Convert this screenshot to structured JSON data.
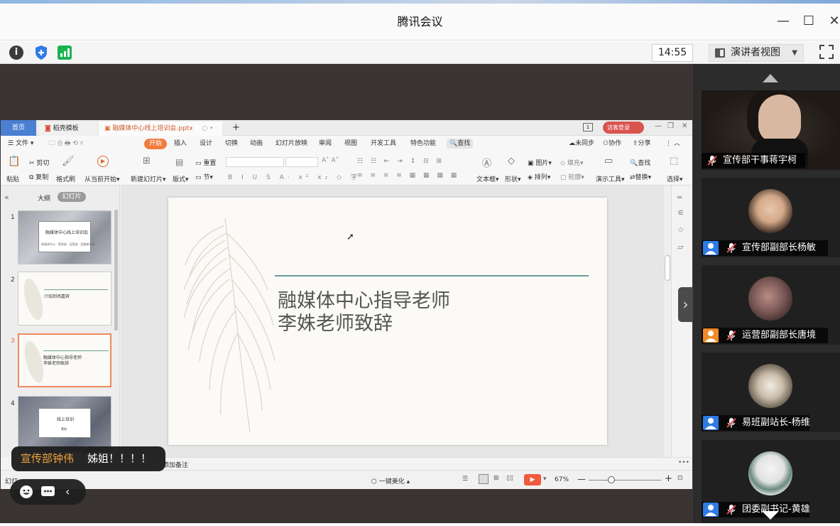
{
  "window": {
    "title": "腾讯会议"
  },
  "toolbar": {
    "clock": "14:55",
    "view_label": "演讲者视图"
  },
  "wps": {
    "tabs": {
      "home": "首页",
      "templates": "稻壳模板",
      "file": "融媒体中心线上培训会.pptx",
      "add": "+"
    },
    "menu": [
      "文件",
      "开始",
      "插入",
      "设计",
      "切换",
      "动画",
      "幻灯片放映",
      "审阅",
      "视图",
      "开发工具",
      "特色功能",
      "查找"
    ],
    "menu_right": {
      "sync": "未同步",
      "collab": "协作",
      "share": "分享",
      "login": "访客登录"
    },
    "ribbon": {
      "paste": "粘贴",
      "cut": "剪切",
      "copy": "复制",
      "format_painter": "格式刷",
      "from_current": "从当前开始",
      "new_slide": "新建幻灯片",
      "layout": "版式",
      "reset": "重置",
      "section": "节",
      "textbox": "文本框",
      "shape": "形状",
      "picture": "图片",
      "arrange": "排列",
      "fill": "填充",
      "outline": "轮廓",
      "present_tools": "演示工具",
      "find": "查找",
      "replace": "替换",
      "select": "选择"
    },
    "pane_tabs": {
      "outline": "大纲",
      "slides": "幻灯片"
    },
    "thumbs": [
      {
        "num": "1",
        "title": "融媒体中心线上培训会",
        "sub": "新媒体中心 · 策划部 · 运营部 · 团委新闻部"
      },
      {
        "num": "2",
        "title": "介绍到场嘉宾"
      },
      {
        "num": "3",
        "line1": "融媒体中心指导老师",
        "line2": "李姝老师致辞"
      },
      {
        "num": "4",
        "title": "线上培训",
        "sub": "策划"
      }
    ],
    "slide": {
      "line1": "融媒体中心指导老师",
      "line2": "李姝老师致辞"
    },
    "notes": "添加备注",
    "status": {
      "left": "幻灯",
      "beautify": "一键美化",
      "zoom": "67%"
    }
  },
  "chat": {
    "name": "宣传部钟伟",
    "message": "姊姐！！！！"
  },
  "participants": [
    {
      "name": "宣传部干事蒋宇柯",
      "avatar_color": "#3b3b3b"
    },
    {
      "name": "宣传部副部长杨敏",
      "avatar_color": "#2f7be6"
    },
    {
      "name": "运营部副部长唐境",
      "avatar_color": "#f08a24"
    },
    {
      "name": "易班副站长-杨维",
      "avatar_color": "#2f7be6"
    },
    {
      "name": "团委副书记-黄雄",
      "avatar_color": "#2f7be6"
    }
  ]
}
